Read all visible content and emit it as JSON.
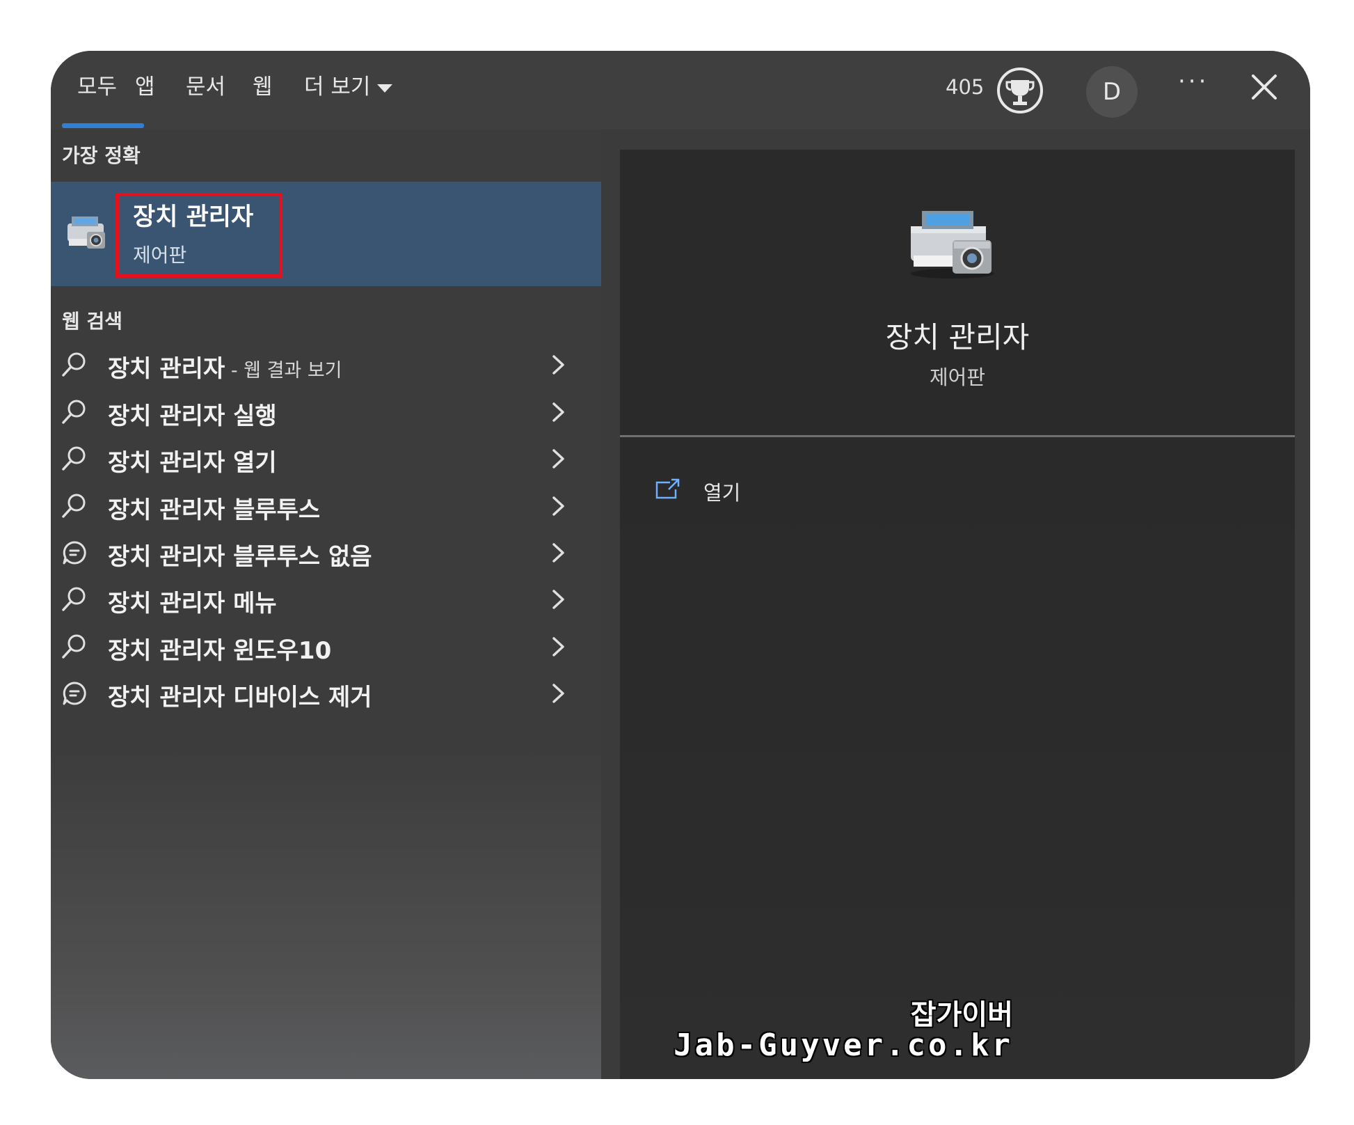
{
  "tabs": {
    "all": "모두",
    "apps": "앱",
    "documents": "문서",
    "web": "웹",
    "more": "더 보기"
  },
  "header": {
    "points": "405",
    "avatar_letter": "D",
    "more_glyph": "···"
  },
  "left": {
    "best_match_label": "가장 정확",
    "best_match": {
      "title": "장치 관리자",
      "subtitle": "제어판",
      "icon": "device-manager-icon"
    },
    "web_search_label": "웹 검색",
    "results": [
      {
        "text": "장치 관리자",
        "suffix": " - 웹 결과 보기",
        "icon": "search-icon"
      },
      {
        "text": "장치 관리자 실행",
        "icon": "search-icon"
      },
      {
        "text": "장치 관리자 열기",
        "icon": "search-icon"
      },
      {
        "text": "장치 관리자 블루투스",
        "icon": "search-icon"
      },
      {
        "text": "장치 관리자 블루투스 없음",
        "icon": "chat-icon"
      },
      {
        "text": "장치 관리자 메뉴",
        "icon": "search-icon"
      },
      {
        "text": "장치 관리자 윈도우10",
        "icon": "search-icon"
      },
      {
        "text": "장치 관리자 디바이스 제거",
        "icon": "chat-icon"
      }
    ]
  },
  "right": {
    "title": "장치 관리자",
    "subtitle": "제어판",
    "open_label": "열기"
  },
  "watermark": {
    "line1": "잡가이버",
    "line2": "Jab-Guyver.co.kr"
  },
  "colors": {
    "accent": "#2f7fd6",
    "selected_bg": "#3a5572",
    "highlight_border": "#e3101e"
  }
}
